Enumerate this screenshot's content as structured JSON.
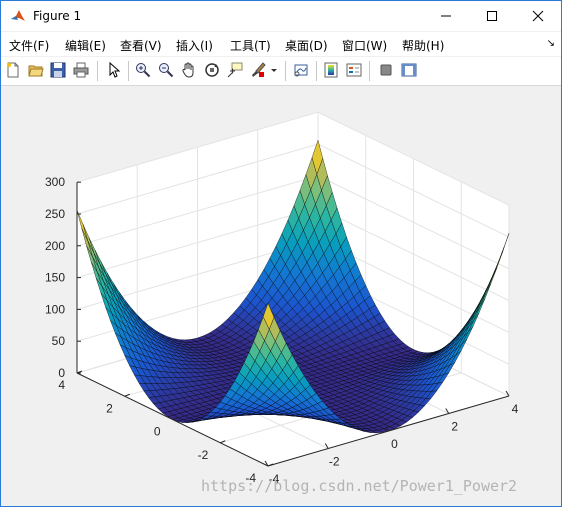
{
  "window": {
    "title": "Figure 1"
  },
  "menu": [
    "文件(F)",
    "编辑(E)",
    "查看(V)",
    "插入(I)",
    "工具(T)",
    "桌面(D)",
    "窗口(W)",
    "帮助(H)"
  ],
  "toolbar": [
    "new-figure",
    "open-file",
    "save",
    "print",
    "edit-plot",
    "zoom-in",
    "zoom-out",
    "pan",
    "rotate-3d",
    "data-cursor",
    "brush",
    "link-plot",
    "colorbar",
    "legend",
    "hide-plot-tools",
    "show-plot-tools"
  ],
  "chart_data": {
    "type": "surface",
    "function": "z = x^2 * y^2 (meshgrid over [-4,4] x [-4,4])",
    "x_ticks": [
      "-4",
      "-2",
      "0",
      "2",
      "4"
    ],
    "y_ticks": [
      "-4",
      "-2",
      "0",
      "2",
      "4"
    ],
    "z_ticks": [
      "0",
      "50",
      "100",
      "150",
      "200",
      "250",
      "300"
    ],
    "xlim": [
      -4,
      4
    ],
    "ylim": [
      -4,
      4
    ],
    "zlim": [
      0,
      300
    ],
    "z_max": 256,
    "colormap": "parula",
    "grid": true,
    "view": [
      -37.5,
      30
    ]
  },
  "watermark": "https://blog.csdn.net/Power1_Power2"
}
